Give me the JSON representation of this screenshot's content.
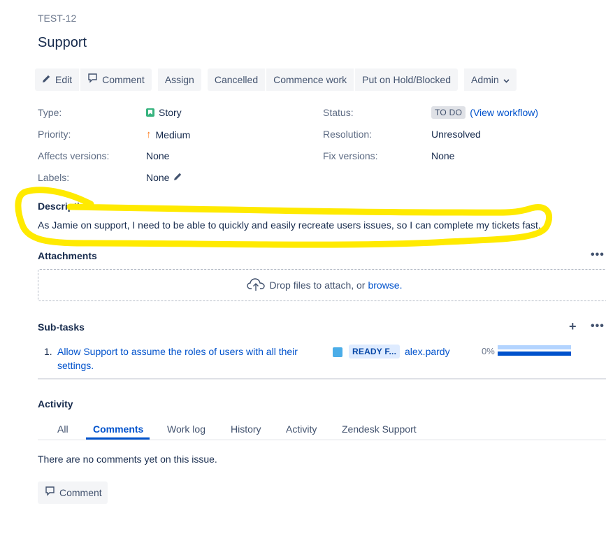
{
  "issue": {
    "key": "TEST-12",
    "title": "Support"
  },
  "toolbar": {
    "edit": "Edit",
    "comment": "Comment",
    "assign": "Assign",
    "cancelled": "Cancelled",
    "commence": "Commence work",
    "hold": "Put on Hold/Blocked",
    "admin": "Admin"
  },
  "details": {
    "type_label": "Type:",
    "type_value": "Story",
    "priority_label": "Priority:",
    "priority_value": "Medium",
    "affects_label": "Affects versions:",
    "affects_value": "None",
    "labels_label": "Labels:",
    "labels_value": "None",
    "status_label": "Status:",
    "status_value": "TO DO",
    "workflow_link": "(View workflow)",
    "resolution_label": "Resolution:",
    "resolution_value": "Unresolved",
    "fix_label": "Fix versions:",
    "fix_value": "None"
  },
  "description": {
    "heading": "Description",
    "text": "As Jamie on support, I need to be able to quickly and easily recreate users issues, so I can complete my tickets fast."
  },
  "attachments": {
    "heading": "Attachments",
    "drop_text": "Drop files to attach, or",
    "browse": "browse."
  },
  "subtasks": {
    "heading": "Sub-tasks",
    "items": [
      {
        "number": "1.",
        "title_line1": "Allow Support to assume the roles of users with all their",
        "title_line2": "settings.",
        "status": "READY F...",
        "assignee": "alex.pardy",
        "progress": "0%",
        "progress_value": 0
      }
    ]
  },
  "activity": {
    "heading": "Activity",
    "tabs": [
      "All",
      "Comments",
      "Work log",
      "History",
      "Activity",
      "Zendesk Support"
    ],
    "active_tab": "Comments",
    "empty_text": "There are no comments yet on this issue.",
    "comment_button": "Comment"
  },
  "colors": {
    "accent": "#0052cc",
    "highlight": "#ffea00",
    "story": "#36b37e",
    "priority_medium": "#ff7a1a"
  }
}
